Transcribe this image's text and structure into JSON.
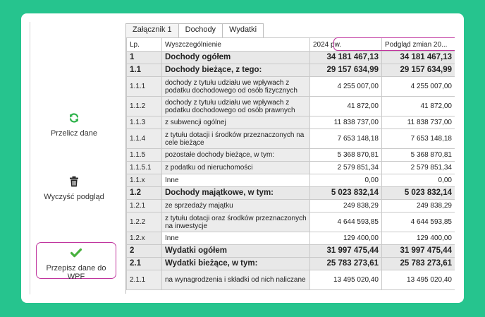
{
  "sidebar": {
    "recalc_label": "Przelicz dane",
    "clear_label": "Wyczyść podgląd",
    "copy_label": "Przepisz dane do WPF"
  },
  "tabs": [
    "Załącznik 1",
    "Dochody",
    "Wydatki"
  ],
  "columns": {
    "lp": "Lp.",
    "desc": "Wyszczególnienie",
    "col_2024": "2024 pw.",
    "col_preview": "Podgląd zmian 20..."
  },
  "colors": {
    "background": "#26c48e",
    "highlight": "#c0359e",
    "icon_green": "#2db24a"
  },
  "rows": [
    {
      "lp": "1",
      "desc": "Dochody ogółem",
      "v1": "34 181 467,13",
      "v2": "34 181 467,13"
    },
    {
      "lp": "1.1",
      "desc": "Dochody bieżące, z tego:",
      "v1": "29 157 634,99",
      "v2": "29 157 634,99"
    },
    {
      "lp": "1.1.1",
      "desc": "dochody z tytułu udziału we wpływach z podatku dochodowego od osób fizycznych",
      "v1": "4 255 007,00",
      "v2": "4 255 007,00"
    },
    {
      "lp": "1.1.2",
      "desc": "dochody z tytułu udziału we wpływach z podatku dochodowego od osób prawnych",
      "v1": "41 872,00",
      "v2": "41 872,00"
    },
    {
      "lp": "1.1.3",
      "desc": "z subwencji ogólnej",
      "v1": "11 838 737,00",
      "v2": "11 838 737,00"
    },
    {
      "lp": "1.1.4",
      "desc": "z tytułu dotacji i środków przeznaczonych na cele bieżące",
      "v1": "7 653 148,18",
      "v2": "7 653 148,18"
    },
    {
      "lp": "1.1.5",
      "desc": "pozostałe dochody bieżące, w tym:",
      "v1": "5 368 870,81",
      "v2": "5 368 870,81"
    },
    {
      "lp": "1.1.5.1",
      "desc": "z podatku od nieruchomości",
      "v1": "2 579 851,34",
      "v2": "2 579 851,34"
    },
    {
      "lp": "1.1.x",
      "desc": "Inne",
      "v1": "0,00",
      "v2": "0,00"
    },
    {
      "lp": "1.2",
      "desc": "Dochody majątkowe, w tym:",
      "v1": "5 023 832,14",
      "v2": "5 023 832,14"
    },
    {
      "lp": "1.2.1",
      "desc": "ze sprzedaży majątku",
      "v1": "249 838,29",
      "v2": "249 838,29"
    },
    {
      "lp": "1.2.2",
      "desc": "z tytułu dotacji oraz środków przeznaczonych na inwestycje",
      "v1": "4 644 593,85",
      "v2": "4 644 593,85"
    },
    {
      "lp": "1.2.x",
      "desc": "Inne",
      "v1": "129 400,00",
      "v2": "129 400,00"
    },
    {
      "lp": "2",
      "desc": "Wydatki ogółem",
      "v1": "31 997 475,44",
      "v2": "31 997 475,44"
    },
    {
      "lp": "2.1",
      "desc": "Wydatki bieżące, w tym:",
      "v1": "25 783 273,61",
      "v2": "25 783 273,61"
    },
    {
      "lp": "2.1.1",
      "desc": "na wynagrodzenia i składki od nich naliczane",
      "v1": "13 495 020,40",
      "v2": "13 495 020,40"
    }
  ]
}
